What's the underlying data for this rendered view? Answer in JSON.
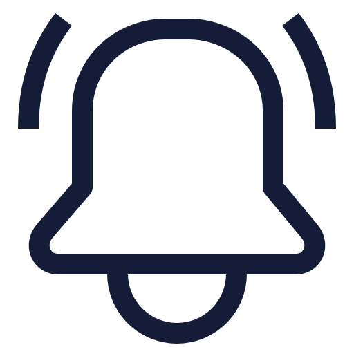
{
  "icon": {
    "name": "bell-ringing-icon",
    "stroke_color": "#141c38",
    "background_color": "#ffffff"
  }
}
